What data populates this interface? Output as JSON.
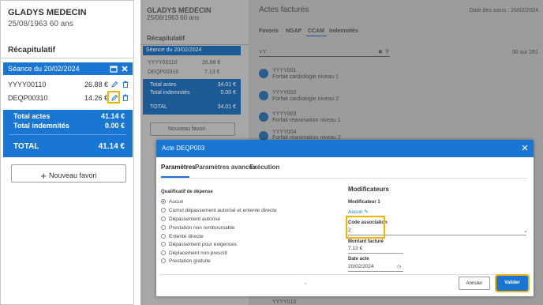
{
  "patient": {
    "name": "GLADYS MEDECIN",
    "dob": "25/08/1963 60 ans"
  },
  "recap": {
    "title": "Récapitulatif",
    "session_label": "Séance du 20/02/2024",
    "acts": [
      {
        "code": "YYYY00110",
        "amount": "26.88 €"
      },
      {
        "code": "DEQP00310",
        "amount": "14.26 €"
      }
    ],
    "totals": {
      "actes_label": "Total actes",
      "actes_value": "41.14 €",
      "indemnites_label": "Total indemnités",
      "indemnites_value": "0.00 €",
      "total_label": "TOTAL",
      "total_value": "41.14 €"
    },
    "favori_button": "Nouveau favori"
  },
  "right_recap": {
    "acts": [
      {
        "code": "YYYY00110",
        "amount": "26.88 €"
      },
      {
        "code": "DEQP00310",
        "amount": "7.13 €"
      }
    ],
    "totals": {
      "actes_label": "Total actes",
      "actes_value": "34.01 €",
      "indemnites_label": "Total indemnités",
      "indemnites_value": "0.00 €",
      "total_label": "TOTAL",
      "total_value": "34.01 €"
    }
  },
  "main": {
    "title": "Actes facturés",
    "date_soins": "Date des soins : 20/02/2024",
    "tabs": [
      "Favoris",
      "NGAP",
      "CCAM",
      "Indemnités"
    ],
    "search_value": "YY",
    "result_count": "30 sur 261",
    "results": [
      {
        "code": "YYYY001",
        "label": "Forfait cardiologie niveau 1"
      },
      {
        "code": "YYYY002",
        "label": "Forfait cardiologie niveau 2"
      },
      {
        "code": "YYYY003",
        "label": "Forfait réanimation niveau 1"
      },
      {
        "code": "YYYY004",
        "label": "Forfait réanimation niveau 2"
      }
    ],
    "partial_bottom": "YYYY010"
  },
  "modal": {
    "title": "Acte DEQP003",
    "tabs": [
      "Paramètres",
      "Paramètres avancés",
      "Exécution"
    ],
    "qualificatif_label": "Qualificatif de dépense",
    "options": [
      "Aucun",
      "Cumul dépassement autorisé et entente directe",
      "Dépassement autorisé",
      "Prestation non remboursable",
      "Entente directe",
      "Dépassement pour exigences",
      "Déplacement non prescrit",
      "Prestation gratuite"
    ],
    "modificateurs_title": "Modificateurs",
    "modificateur1_label": "Modificateur 1",
    "modificateur1_value": "Aucun",
    "code_association_label": "Code association",
    "code_association_value": "2",
    "montant_label": "Montant facturé",
    "montant_value": "7.13 €",
    "date_label": "Date acte",
    "date_value": "20/02/2024",
    "cancel_label": "Annuler",
    "validate_label": "Valider"
  },
  "colors": {
    "primary": "#1976d2",
    "highlight": "#f4b400"
  }
}
